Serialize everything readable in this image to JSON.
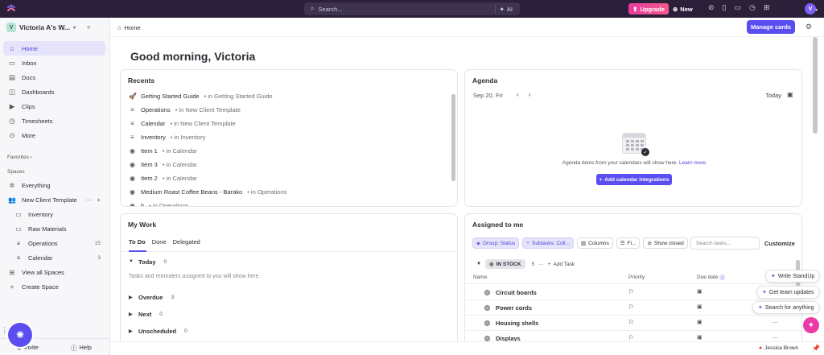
{
  "topbar": {
    "search_placeholder": "Search...",
    "ai_label": "AI",
    "upgrade_label": "Upgrade",
    "new_label": "New",
    "avatar_initial": "V"
  },
  "sidebar": {
    "workspace_initial": "V",
    "workspace_name": "Victoria A's W...",
    "nav": [
      {
        "label": "Home",
        "icon": "home-icon",
        "glyph": "⌂",
        "active": true
      },
      {
        "label": "Inbox",
        "icon": "inbox-icon",
        "glyph": "▭"
      },
      {
        "label": "Docs",
        "icon": "docs-icon",
        "glyph": "▤"
      },
      {
        "label": "Dashboards",
        "icon": "dashboard-icon",
        "glyph": "◫"
      },
      {
        "label": "Clips",
        "icon": "clips-icon",
        "glyph": "▶"
      },
      {
        "label": "Timesheets",
        "icon": "timesheets-icon",
        "glyph": "◷"
      },
      {
        "label": "More",
        "icon": "more-icon",
        "glyph": "⊙"
      }
    ],
    "favorites_label": "Favorites",
    "spaces_label": "Spaces",
    "spaces": [
      {
        "label": "Everything",
        "icon": "everything-icon",
        "glyph": "✲",
        "child": false,
        "count": ""
      },
      {
        "label": "New Client Template",
        "icon": "team-space-icon",
        "glyph": "👥",
        "child": false,
        "count": ""
      },
      {
        "label": "Inventory",
        "icon": "folder-icon",
        "glyph": "▭",
        "child": true,
        "count": ""
      },
      {
        "label": "Raw Materials",
        "icon": "folder-icon",
        "glyph": "▭",
        "child": true,
        "count": ""
      },
      {
        "label": "Operations",
        "icon": "list-icon",
        "glyph": "≡",
        "child": true,
        "count": "15"
      },
      {
        "label": "Calendar",
        "icon": "list-icon",
        "glyph": "≡",
        "child": true,
        "count": "3"
      },
      {
        "label": "View all Spaces",
        "icon": "grid-icon",
        "glyph": "⊞",
        "child": false,
        "count": ""
      },
      {
        "label": "Create Space",
        "icon": "plus-icon",
        "glyph": "+",
        "child": false,
        "count": ""
      }
    ],
    "invite_label": "Invite",
    "help_label": "Help"
  },
  "header": {
    "breadcrumb": "Home",
    "manage_cards_label": "Manage cards"
  },
  "greeting": "Good morning, Victoria",
  "recents": {
    "title": "Recents",
    "items": [
      {
        "name": "Getting Started Guide",
        "loc": "• in Getting Started Guide",
        "icon": "rocket-icon",
        "glyph": "🚀"
      },
      {
        "name": "Operations",
        "loc": "• in New Client Template",
        "icon": "list-icon",
        "glyph": "≡"
      },
      {
        "name": "Calendar",
        "loc": "• in New Client Template",
        "icon": "list-icon",
        "glyph": "≡"
      },
      {
        "name": "Inventory",
        "loc": "• in Inventory",
        "icon": "list-icon",
        "glyph": "≡"
      },
      {
        "name": "Item 1",
        "loc": "• in Calendar",
        "icon": "task-icon",
        "glyph": "◉"
      },
      {
        "name": "Item 3",
        "loc": "• in Calendar",
        "icon": "task-icon",
        "glyph": "◉"
      },
      {
        "name": "Item 2",
        "loc": "• in Calendar",
        "icon": "task-icon",
        "glyph": "◉"
      },
      {
        "name": "Medium Roast Coffee Beans - Barako",
        "loc": "• in Operations",
        "icon": "task-icon",
        "glyph": "◉"
      },
      {
        "name": "h",
        "loc": "• in Operations",
        "icon": "task-icon",
        "glyph": "◉"
      }
    ]
  },
  "agenda": {
    "title": "Agenda",
    "date": "Sep 20, Fri",
    "today_label": "Today",
    "message": "Agenda items from your calendars will show here.",
    "learn_more": "Learn more",
    "add_button": "Add calendar integrations"
  },
  "mywork": {
    "title": "My Work",
    "tabs": [
      "To Do",
      "Done",
      "Delegated"
    ],
    "groups": [
      {
        "label": "Today",
        "count": "0",
        "expanded": true
      },
      {
        "label": "Overdue",
        "count": "3",
        "expanded": false
      },
      {
        "label": "Next",
        "count": "0",
        "expanded": false
      },
      {
        "label": "Unscheduled",
        "count": "0",
        "expanded": false
      }
    ],
    "empty_text": "Tasks and reminders assigned to you will show here."
  },
  "assigned": {
    "title": "Assigned to me",
    "chips": {
      "group": "Group: Status",
      "subtasks": "Subtasks: Coll...",
      "columns": "Columns",
      "filter": "Fi...",
      "show_closed": "Show closed"
    },
    "search_placeholder": "Search tasks...",
    "customize_label": "Customize",
    "status_label": "IN STOCK",
    "status_count": "5",
    "add_task_label": "Add Task",
    "columns": [
      "Name",
      "Priority",
      "Due date"
    ],
    "tasks": [
      "Circuit boards",
      "Power cords",
      "Housing shells",
      "Displays"
    ]
  },
  "floating": {
    "write_standup": "Write StandUp",
    "team_updates": "Get team updates",
    "search_anything": "Search for anything"
  },
  "bottom": {
    "recorder_name": "Jessica Brown"
  }
}
